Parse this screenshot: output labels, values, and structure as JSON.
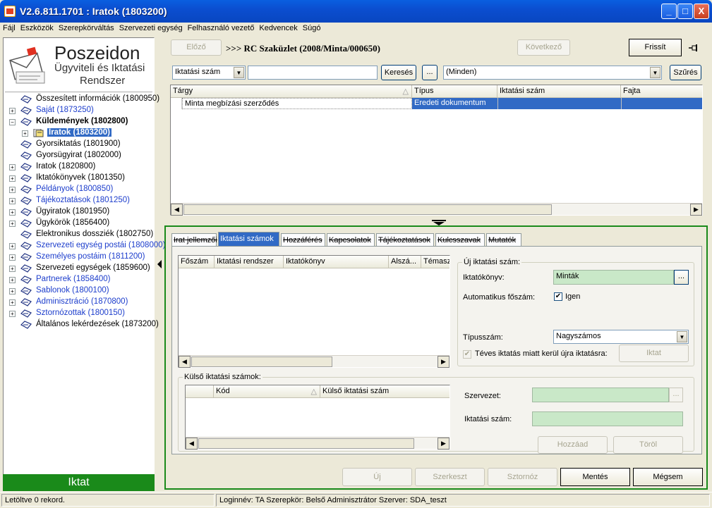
{
  "window": {
    "title": "V2.6.811.1701 : Iratok (1803200)",
    "minimize": "_",
    "maximize": "□",
    "close": "X"
  },
  "menu": [
    "Fájl",
    "Eszközök",
    "Szerepkörváltás",
    "Szervezeti egység",
    "Felhasználó vezető",
    "Kedvencek",
    "Súgó"
  ],
  "logo": {
    "line1": "Poszeidon",
    "line2": "Ügyviteli és Iktatási",
    "line3": "Rendszer"
  },
  "tree": [
    {
      "label": "Összesített információk (1800950)",
      "expander": "",
      "blue": false,
      "bold": false,
      "indent": 0
    },
    {
      "label": "Saját (1873250)",
      "expander": "+",
      "blue": true,
      "bold": false,
      "indent": 0
    },
    {
      "label": "Küldemények (1802800)",
      "expander": "−",
      "blue": false,
      "bold": true,
      "indent": 0
    },
    {
      "label": "Iratok (1803200)",
      "expander": "+",
      "blue": false,
      "bold": true,
      "indent": 1,
      "selected": true
    },
    {
      "label": "Gyorsiktatás (1801900)",
      "expander": "",
      "blue": false,
      "bold": false,
      "indent": 0
    },
    {
      "label": "Gyorsügyirat (1802000)",
      "expander": "",
      "blue": false,
      "bold": false,
      "indent": 0
    },
    {
      "label": "Iratok (1820800)",
      "expander": "+",
      "blue": false,
      "bold": false,
      "indent": 0
    },
    {
      "label": "Iktatókönyvek (1801350)",
      "expander": "+",
      "blue": false,
      "bold": false,
      "indent": 0
    },
    {
      "label": "Példányok (1800850)",
      "expander": "+",
      "blue": true,
      "bold": false,
      "indent": 0
    },
    {
      "label": "Tájékoztatások (1801250)",
      "expander": "+",
      "blue": true,
      "bold": false,
      "indent": 0
    },
    {
      "label": "Ügyiratok (1801950)",
      "expander": "+",
      "blue": false,
      "bold": false,
      "indent": 0
    },
    {
      "label": "Ügykörök (1856400)",
      "expander": "+",
      "blue": false,
      "bold": false,
      "indent": 0
    },
    {
      "label": "Elektronikus dossziék (1802750)",
      "expander": "",
      "blue": false,
      "bold": false,
      "indent": 0
    },
    {
      "label": "Szervezeti egység postái (1808000)",
      "expander": "+",
      "blue": true,
      "bold": false,
      "indent": 0
    },
    {
      "label": "Személyes postáim (1811200)",
      "expander": "+",
      "blue": true,
      "bold": false,
      "indent": 0
    },
    {
      "label": "Szervezeti egységek (1859600)",
      "expander": "+",
      "blue": false,
      "bold": false,
      "indent": 0
    },
    {
      "label": "Partnerek (1858400)",
      "expander": "+",
      "blue": true,
      "bold": false,
      "indent": 0
    },
    {
      "label": "Sablonok (1800100)",
      "expander": "+",
      "blue": true,
      "bold": false,
      "indent": 0
    },
    {
      "label": "Adminisztráció (1870800)",
      "expander": "+",
      "blue": true,
      "bold": false,
      "indent": 0
    },
    {
      "label": "Sztornózottak (1800150)",
      "expander": "+",
      "blue": true,
      "bold": false,
      "indent": 0
    },
    {
      "label": "Általános lekérdezések (1873200)",
      "expander": "",
      "blue": false,
      "bold": false,
      "indent": 0
    }
  ],
  "iktat_button": "Iktat",
  "top": {
    "prev": "Előző",
    "record_title": ">>> RC Szaküzlet (2008/Minta/000650)",
    "next": "Következő",
    "refresh": "Frissít",
    "pin_icon": "pin-icon",
    "search_field": "Iktatási szám",
    "search_value": "",
    "search_button": "Keresés",
    "ellipsis": "...",
    "filter_value": "(Minden)",
    "filter_button": "Szűrés"
  },
  "main_grid": {
    "columns": [
      "Tárgy",
      "Típus",
      "Iktatási szám",
      "Fajta"
    ],
    "rows": [
      [
        "Minta megbízási szerződés",
        "Eredeti dokumentum",
        "",
        ""
      ]
    ]
  },
  "tabs": [
    "Irat jellemzői",
    "Iktatási számok",
    "Hozzáférés",
    "Kapcsolatok",
    "Tájékoztatások",
    "Kulcsszavak",
    "Mutatók"
  ],
  "active_tab": 1,
  "ikt_grid": {
    "columns": [
      "Főszám",
      "Iktatási rendszer",
      "Iktatókönyv",
      "Alszá...",
      "Témasz"
    ]
  },
  "uj": {
    "group_label": "Új iktatási szám:",
    "konyv_label": "Iktatókönyv:",
    "konyv_value": "Minták",
    "auto_label": "Automatikus főszám:",
    "auto_value": "Igen",
    "tipus_label": "Típusszám:",
    "tipus_value": "Nagyszámos",
    "teves_label": "Téves iktatás miatt kerül újra iktatásra:",
    "iktat_button": "Iktat"
  },
  "kulso": {
    "group_label": "Külső iktatási számok:",
    "columns": [
      "Kód",
      "Külső iktatási szám"
    ],
    "szervezet_label": "Szervezet:",
    "iktatasi_label": "Iktatási szám:",
    "hozzaad": "Hozzáad",
    "torol": "Töröl"
  },
  "bottom_buttons": [
    "Új",
    "Szerkeszt",
    "Sztornóz",
    "Mentés",
    "Mégsem"
  ],
  "status": {
    "left": "Letöltve 0 rekord.",
    "right": "Loginnév: TA   Szerepkör: Belső Adminisztrátor   Szerver: SDA_teszt"
  }
}
